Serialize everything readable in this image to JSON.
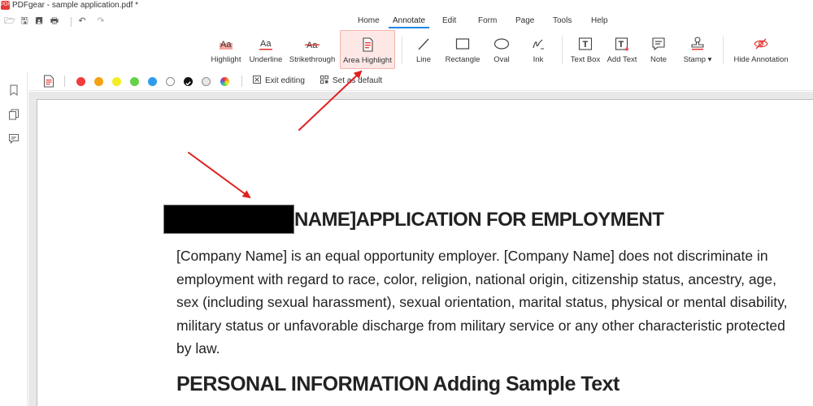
{
  "titlebar": {
    "logo": "PDF",
    "title": "PDFgear - sample application.pdf *"
  },
  "quick_actions": [
    {
      "name": "open-icon",
      "glyph": "🗁"
    },
    {
      "name": "save-icon",
      "glyph": "🖫"
    },
    {
      "name": "save-as-icon",
      "glyph": "🖪"
    },
    {
      "name": "print-icon",
      "glyph": "🖶"
    },
    {
      "name": "undo-icon",
      "glyph": "↶"
    },
    {
      "name": "redo-icon",
      "glyph": "↷"
    }
  ],
  "menu": {
    "items": [
      "Home",
      "Annotate",
      "Edit",
      "Form",
      "Page",
      "Tools",
      "Help"
    ],
    "active": "Annotate",
    "accent": "#1e88e5"
  },
  "ribbon": {
    "tools": [
      {
        "key": "highlight",
        "label": "Highlight",
        "icon": "highlight-text-icon"
      },
      {
        "key": "underline",
        "label": "Underline",
        "icon": "underline-text-icon"
      },
      {
        "key": "strikethrough",
        "label": "Strikethrough",
        "icon": "strikethrough-text-icon"
      },
      {
        "key": "area-highlight",
        "label": "Area Highlight",
        "icon": "area-highlight-icon"
      },
      {
        "key": "line",
        "label": "Line",
        "icon": "line-icon"
      },
      {
        "key": "rectangle",
        "label": "Rectangle",
        "icon": "rectangle-icon"
      },
      {
        "key": "oval",
        "label": "Oval",
        "icon": "oval-icon"
      },
      {
        "key": "ink",
        "label": "Ink",
        "icon": "ink-pen-icon"
      },
      {
        "key": "text-box",
        "label": "Text Box",
        "icon": "text-box-icon"
      },
      {
        "key": "add-text",
        "label": "Add Text",
        "icon": "add-text-icon"
      },
      {
        "key": "note",
        "label": "Note",
        "icon": "note-icon"
      },
      {
        "key": "stamp",
        "label": "Stamp ▾",
        "icon": "stamp-icon"
      },
      {
        "key": "hide-annotation",
        "label": "Hide Annotation",
        "icon": "hide-annotation-icon"
      }
    ],
    "selected": "area-highlight",
    "accent": "#e53935"
  },
  "subbar": {
    "colors": [
      "#f03c3c",
      "#f5a214",
      "#f3ee21",
      "#66d24a",
      "#2e9cec",
      "#ffffff",
      "#111111",
      "#e8e8e8",
      "rainbow"
    ],
    "selected_color": "#111111",
    "exit_label": "Exit editing",
    "set_default_label": "Set as default"
  },
  "document": {
    "heading1": "NAME]APPLICATION FOR EMPLOYMENT",
    "paragraph": "[Company Name] is an equal opportunity employer. [Company Name] does not discriminate in\nemployment with regard to race, color, religion, national origin, citizenship status, ancestry, age,\nsex (including sexual harassment), sexual orientation, marital status, physical or mental disability,\nmilitary status or unfavorable discharge from military service or any other characteristic protected\nby law.",
    "heading2": "PERSONAL INFORMATION Adding Sample Text"
  },
  "annotation_arrow_color": "#e02020"
}
